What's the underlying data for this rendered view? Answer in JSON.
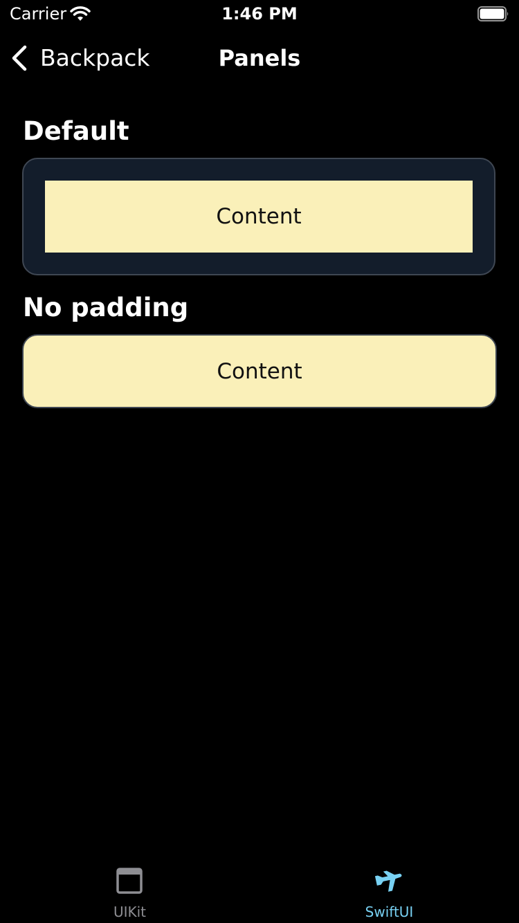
{
  "status_bar": {
    "carrier": "Carrier",
    "time": "1:46 PM"
  },
  "nav": {
    "back_label": "Backpack",
    "title": "Panels"
  },
  "sections": [
    {
      "title": "Default",
      "content": "Content"
    },
    {
      "title": "No padding",
      "content": "Content"
    }
  ],
  "tabs": [
    {
      "label": "UIKit",
      "icon": "window-icon",
      "selected": false
    },
    {
      "label": "SwiftUI",
      "icon": "airplane-icon",
      "selected": true
    }
  ],
  "colors": {
    "background": "#000000",
    "panel_background": "#131d2b",
    "panel_border": "#3f4753",
    "content_fill": "#faf0b9",
    "tab_selected": "#78d1f3",
    "tab_unselected": "#8e8e93"
  }
}
